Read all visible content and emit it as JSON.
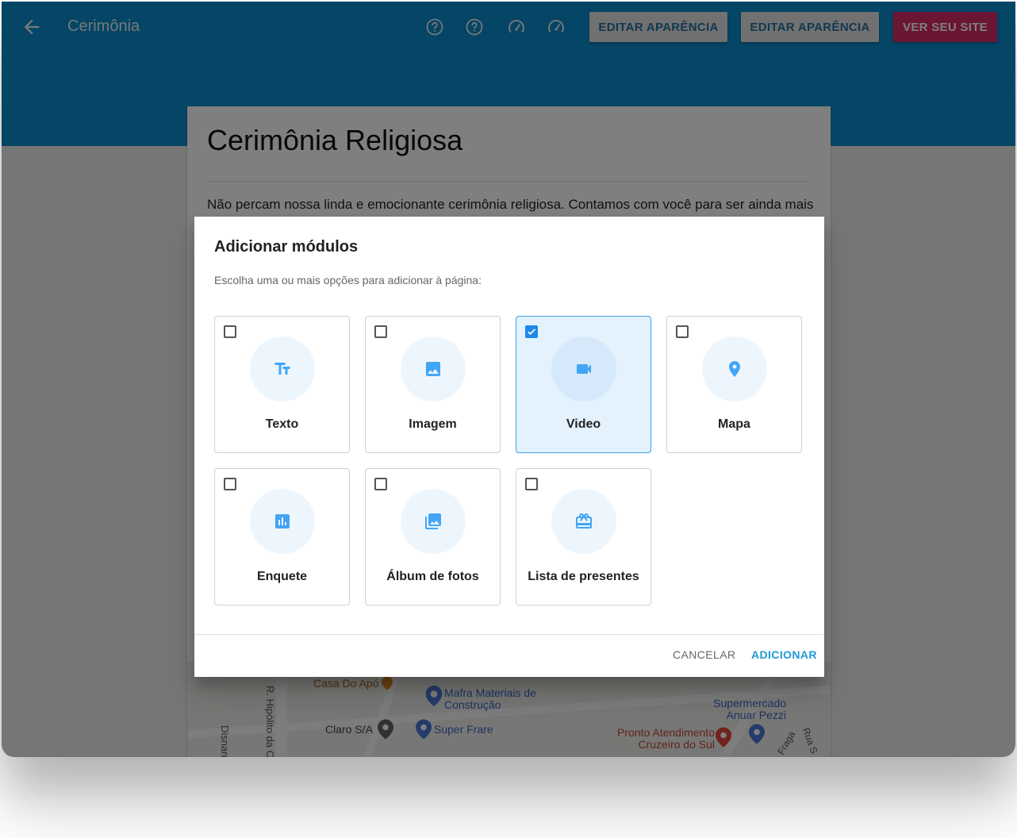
{
  "toolbar": {
    "page_name": "Cerimônia",
    "icons": [
      "arrow-back-icon",
      "help-icon",
      "help-icon",
      "speed-icon",
      "speed-icon"
    ],
    "edit_appearance_1": "EDITAR APARÊNCIA",
    "edit_appearance_2": "EDITAR APARÊNCIA",
    "view_site": "VER SEU SITE"
  },
  "content": {
    "title": "Cerimônia Religiosa",
    "text": "Não percam nossa linda e emocionante cerimônia religiosa. Contamos com você para ser ainda mais"
  },
  "map": {
    "labels": {
      "casa": "Casa Do Apó",
      "street_hipolito": "R. Hipólito da Co",
      "street_disnard": "Disnard",
      "mafra": "Mafra Materiais de Construção",
      "claro": "Claro S/A",
      "super_frare": "Super Frare",
      "supermercado": "Supermercado Anuar Pezzi",
      "pronto": "Pronto Atendimento Cruzeiro do Sul",
      "fraga": "Fraga",
      "rua_s": "Rua S"
    }
  },
  "dialog": {
    "title": "Adicionar módulos",
    "subtitle": "Escolha uma ou mais opções para adicionar à página:",
    "modules": [
      {
        "label": "Texto",
        "icon": "text-fields-icon",
        "checked": false
      },
      {
        "label": "Imagem",
        "icon": "image-icon",
        "checked": false
      },
      {
        "label": "Video",
        "icon": "videocam-icon",
        "checked": true
      },
      {
        "label": "Mapa",
        "icon": "place-icon",
        "checked": false
      },
      {
        "label": "Enquete",
        "icon": "poll-icon",
        "checked": false
      },
      {
        "label": "Álbum de fotos",
        "icon": "photo-library-icon",
        "checked": false
      },
      {
        "label": "Lista de presentes",
        "icon": "gift-card-icon",
        "checked": false
      }
    ],
    "cancel": "CANCELAR",
    "add": "ADICIONAR"
  },
  "colors": {
    "appbar": "#0a8acb",
    "accent": "#1e88e5",
    "view_site": "#d62a6a"
  }
}
